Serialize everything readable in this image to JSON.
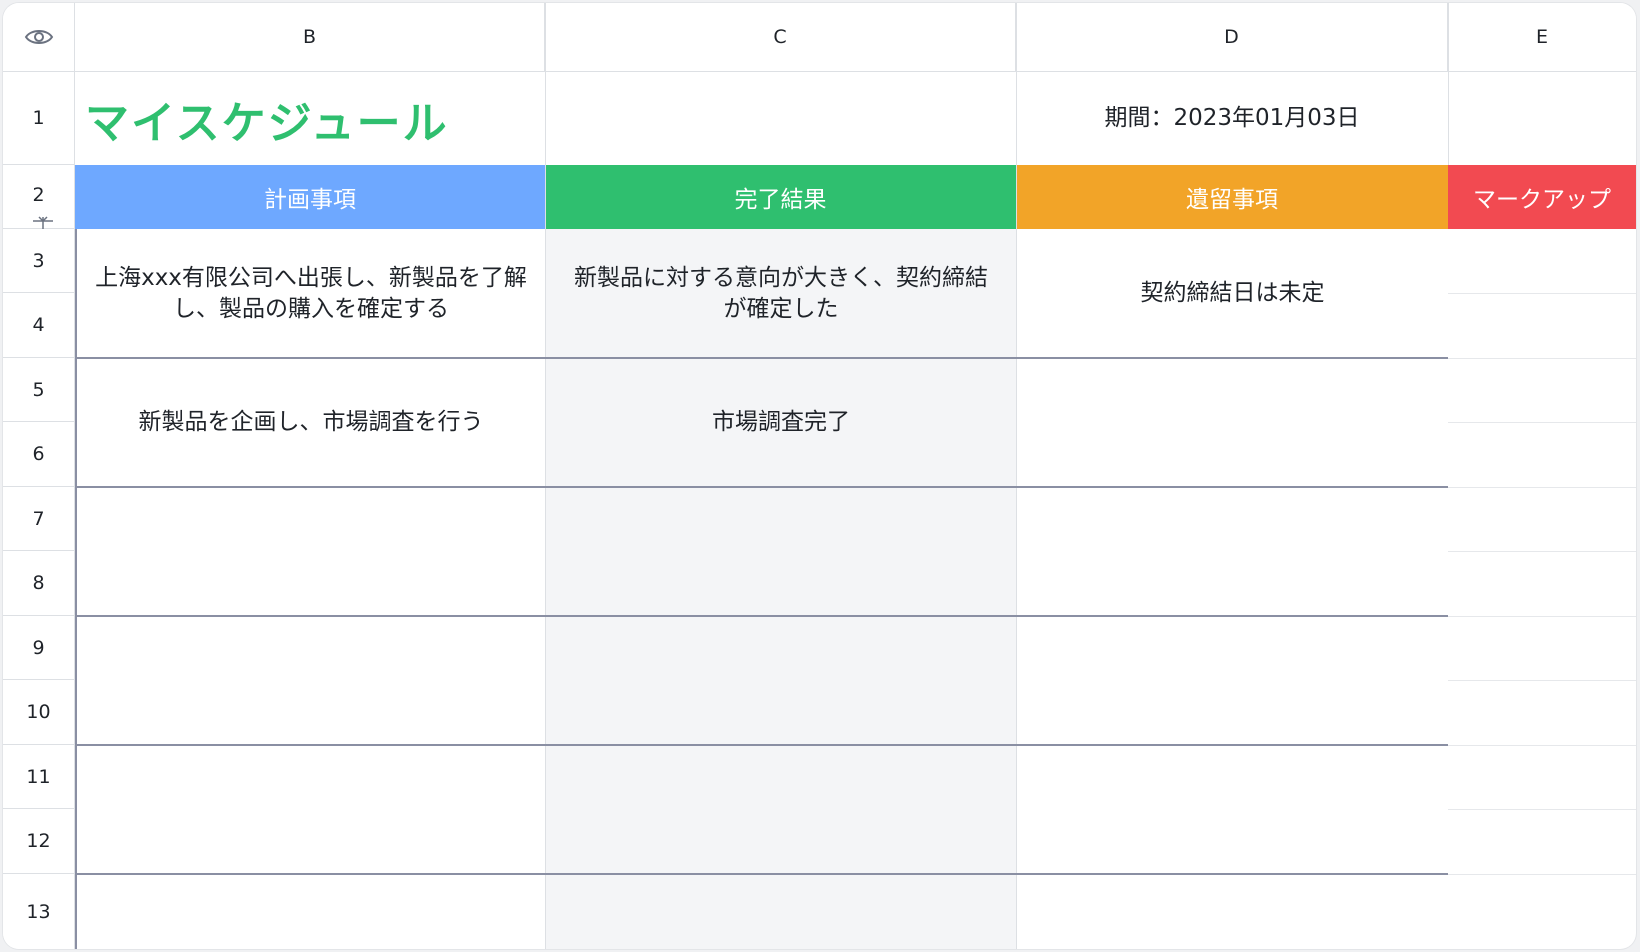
{
  "columns": [
    "B",
    "C",
    "D",
    "E"
  ],
  "rows": [
    "1",
    "2",
    "3",
    "4",
    "5",
    "6",
    "7",
    "8",
    "9",
    "10",
    "11",
    "12",
    "13"
  ],
  "title": "マイスケジュール",
  "period": "期間：2023年01月03日",
  "headers": {
    "plan": "計画事項",
    "result": "完了結果",
    "pending": "遺留事項",
    "markup": "マークアップ"
  },
  "entries": [
    {
      "plan": "上海xxx有限公司へ出張し、新製品を了解し、製品の購入を確定する",
      "result": "新製品に対する意向が大きく、契約締結が確定した",
      "pending": "契約締結日は未定"
    },
    {
      "plan": "新製品を企画し、市場調査を行う",
      "result": "市場調査完了",
      "pending": ""
    }
  ],
  "colors": {
    "title_green": "#2fbf6f",
    "plan_blue": "#6ea8ff",
    "result_green": "#2fbf6f",
    "pending_orange": "#f2a428",
    "markup_red": "#f24a51",
    "result_column_bg": "#f4f5f7"
  },
  "icons": {
    "corner": "eye-icon",
    "row_resize": "row-resize-icon"
  }
}
